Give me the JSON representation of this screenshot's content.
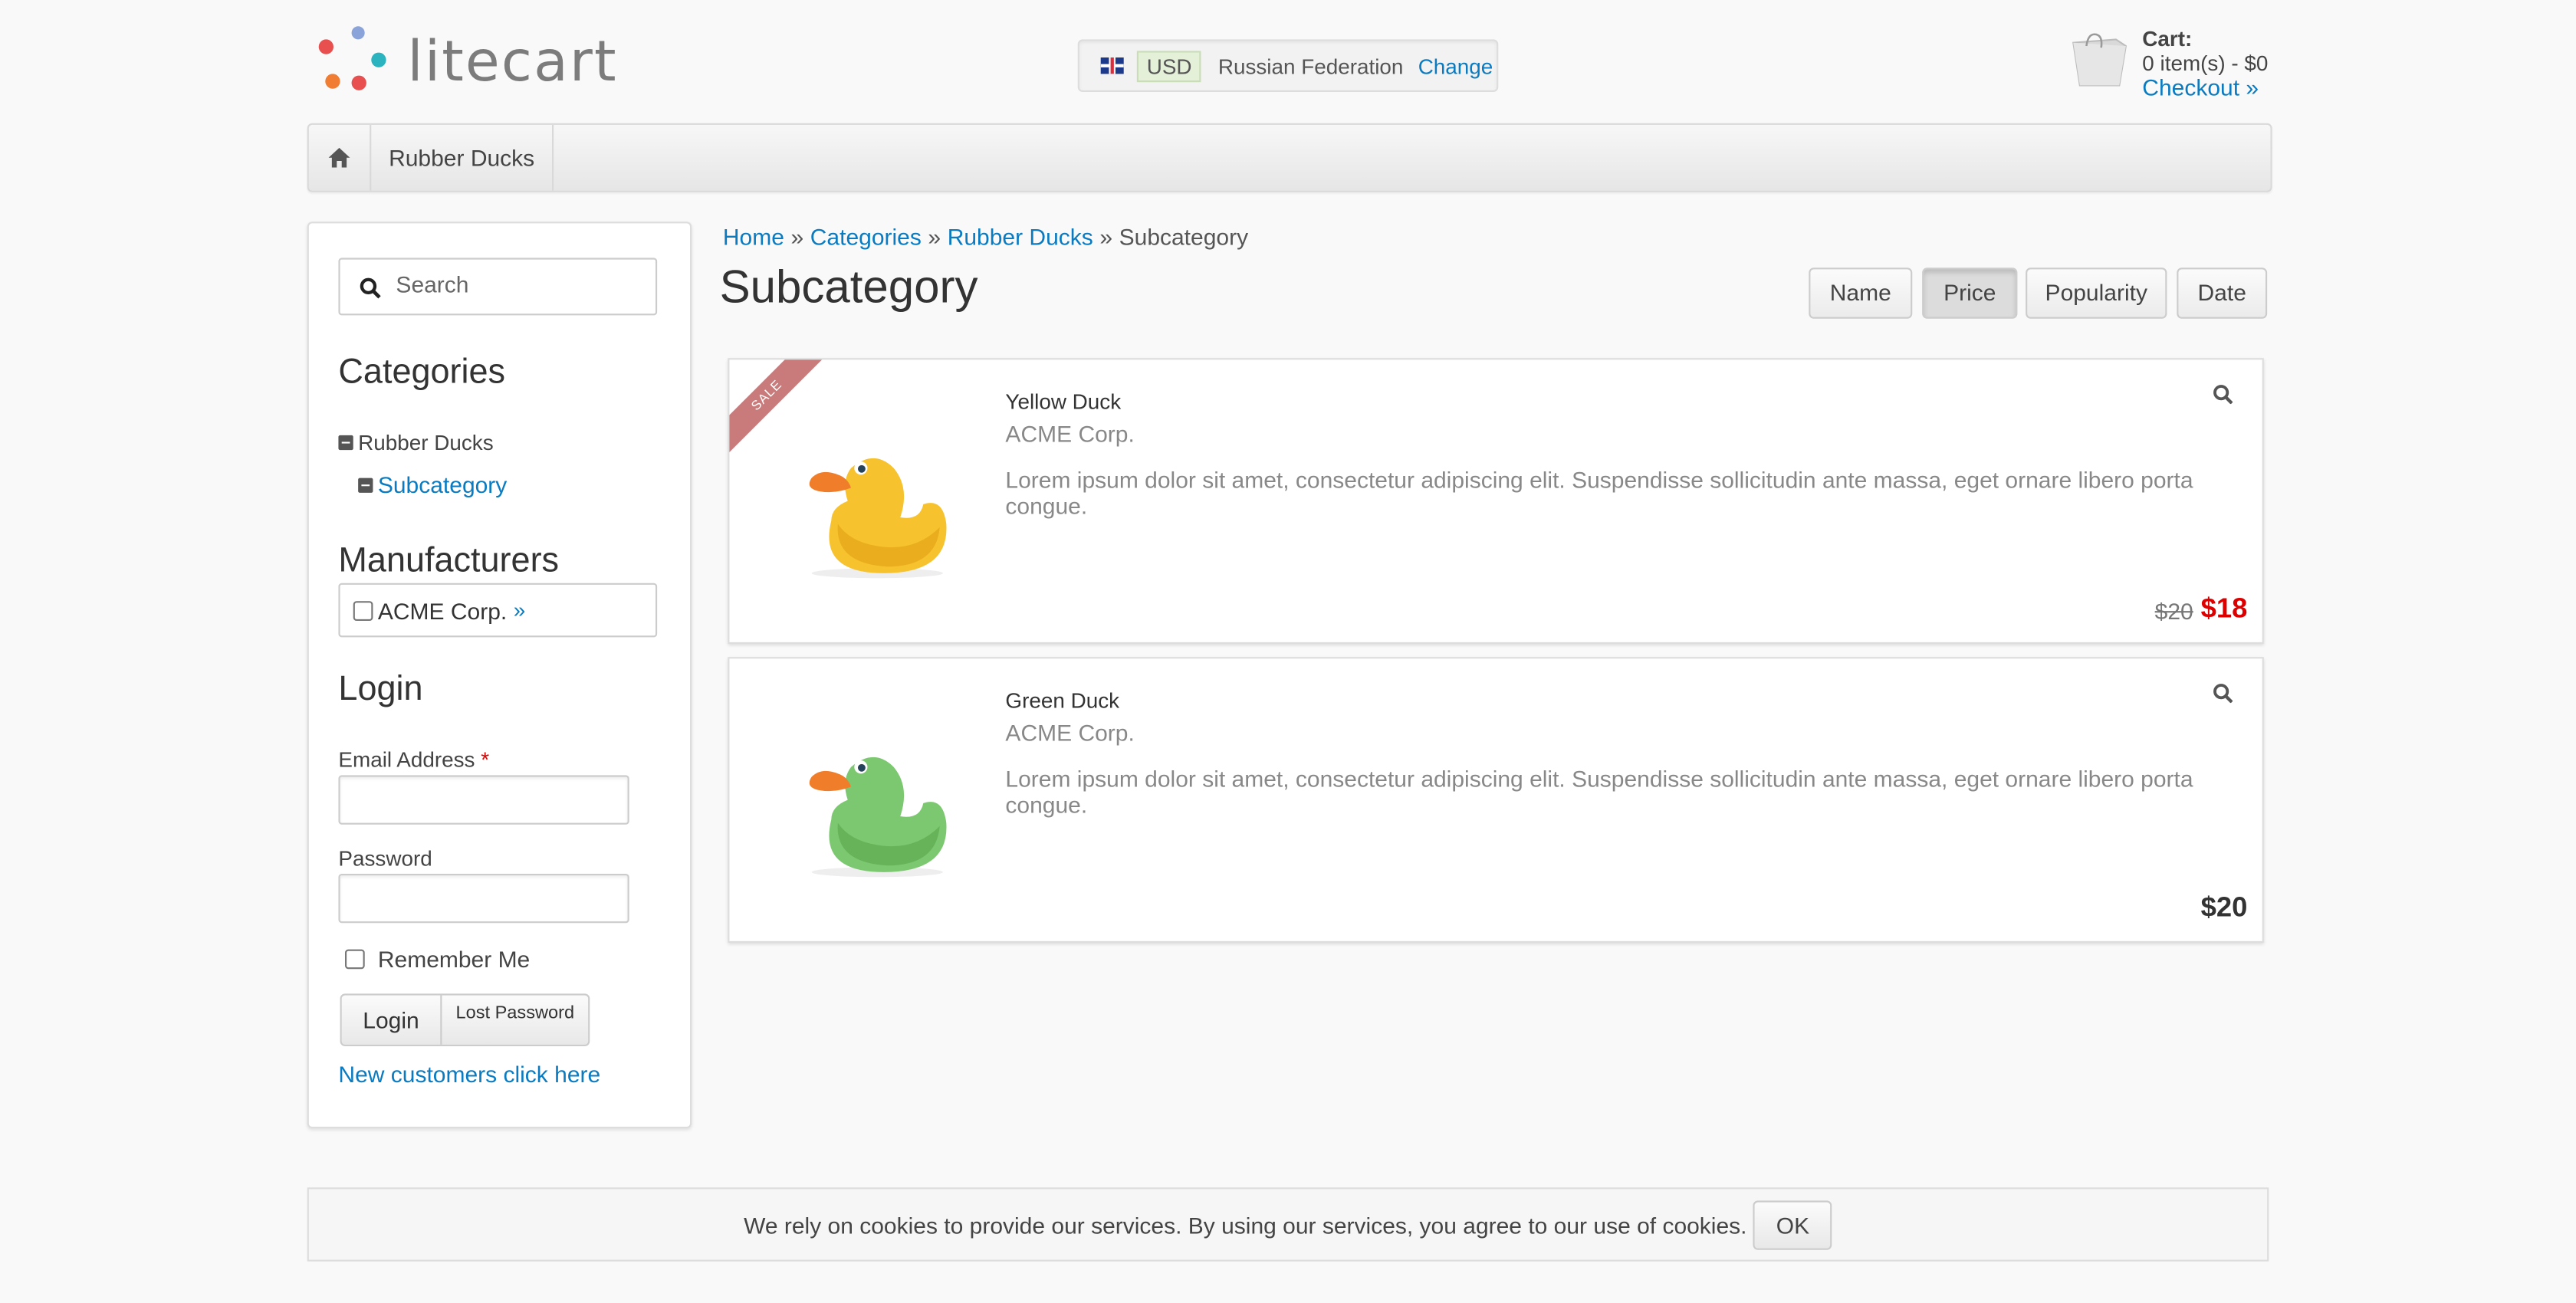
{
  "header": {
    "logo_text": "litecart",
    "currency": "USD",
    "country": "Russian Federation",
    "change_label": "Change",
    "cart": {
      "title": "Cart:",
      "summary": "0 item(s) - $0",
      "checkout_label": "Checkout »"
    }
  },
  "nav": {
    "items": [
      {
        "label": "Rubber Ducks"
      }
    ]
  },
  "sidebar": {
    "search_placeholder": "Search",
    "categories_title": "Categories",
    "categories": [
      {
        "label": "Rubber Ducks"
      },
      {
        "label": "Subcategory"
      }
    ],
    "manufacturers_title": "Manufacturers",
    "manufacturers": [
      {
        "label": "ACME Corp.",
        "link": "»"
      }
    ],
    "login": {
      "title": "Login",
      "email_label": "Email Address",
      "required_mark": "*",
      "password_label": "Password",
      "remember_label": "Remember Me",
      "login_button": "Login",
      "lost_password_button": "Lost Password",
      "new_customers_link": "New customers click here"
    }
  },
  "main": {
    "breadcrumb": [
      "Home",
      "Categories",
      "Rubber Ducks",
      "Subcategory"
    ],
    "breadcrumb_sep": "»",
    "title": "Subcategory",
    "sort": {
      "options": [
        "Name",
        "Price",
        "Popularity",
        "Date"
      ],
      "active": "Price"
    },
    "products": [
      {
        "name": "Yellow Duck",
        "manufacturer": "ACME Corp.",
        "description": "Lorem ipsum dolor sit amet, consectetur adipiscing elit. Suspendisse sollicitudin ante massa, eget ornare libero porta congue.",
        "sale_badge": "SALE",
        "regular_price": "$20",
        "campaign_price": "$18",
        "duck_color": "#f6c22e",
        "image": "yellow-duck-image"
      },
      {
        "name": "Green Duck",
        "manufacturer": "ACME Corp.",
        "description": "Lorem ipsum dolor sit amet, consectetur adipiscing elit. Suspendisse sollicitudin ante massa, eget ornare libero porta congue.",
        "price": "$20",
        "duck_color": "#7cc870",
        "image": "green-duck-image"
      }
    ]
  },
  "cookie_notice": {
    "text": "We rely on cookies to provide our services. By using our services, you agree to our use of cookies.",
    "ok_label": "OK"
  },
  "colors": {
    "link": "#0a7bc1",
    "sale_price": "#dd0000",
    "sale_ribbon": "#c97b7b",
    "background": "#f9f9f9"
  }
}
